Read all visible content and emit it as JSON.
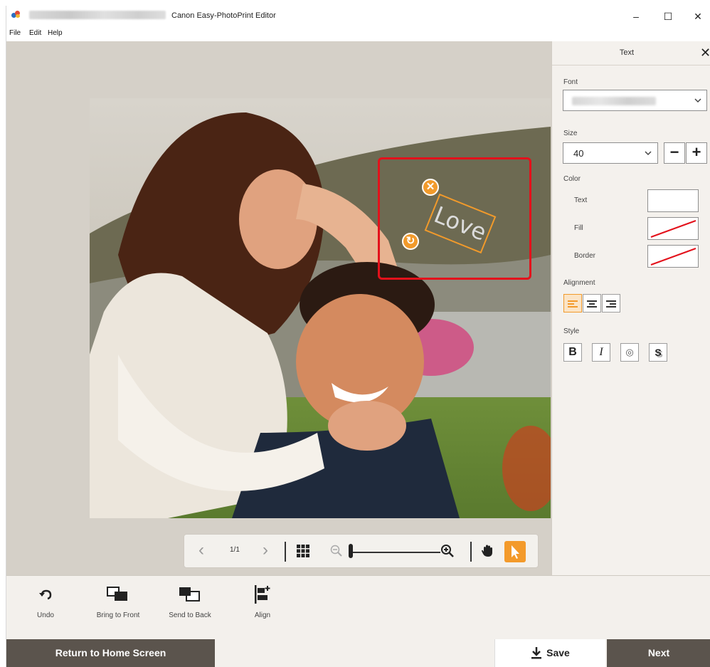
{
  "window": {
    "title": "Canon Easy-PhotoPrint Editor",
    "controls": {
      "minimize": "–",
      "maximize": "☐",
      "close": "✕"
    }
  },
  "menu": [
    "File",
    "Edit",
    "Help"
  ],
  "canvas": {
    "text_object": "Love",
    "delete_handle": "✕",
    "rotate_handle": "↻"
  },
  "zoombar": {
    "page_indicator": "1/1",
    "prev": "‹",
    "next": "›",
    "zoom_level": 0.0
  },
  "panel": {
    "title": "Text",
    "close": "✕",
    "font_label": "Font",
    "size_label": "Size",
    "size_value": "40",
    "minus": "−",
    "plus": "+",
    "color_label": "Color",
    "color_text_label": "Text",
    "color_fill_label": "Fill",
    "color_border_label": "Border",
    "alignment_label": "Alignment",
    "style_label": "Style",
    "style_buttons": [
      "B",
      "I",
      "◎",
      "S"
    ],
    "colors": {
      "text_swatch": "#ffffff",
      "fill_swatch": "none",
      "border_swatch": "none"
    }
  },
  "actions": [
    {
      "label": "Undo",
      "icon": "undo-icon"
    },
    {
      "label": "Bring to Front",
      "icon": "bring-to-front-icon"
    },
    {
      "label": "Send to Back",
      "icon": "send-to-back-icon"
    },
    {
      "label": "Align",
      "icon": "align-icon"
    }
  ],
  "footer": {
    "home": "Return to Home Screen",
    "save": "Save",
    "next": "Next"
  },
  "colors": {
    "accent": "#f39a2b",
    "selection": "#e3111b",
    "dark_button": "#5b544d"
  }
}
